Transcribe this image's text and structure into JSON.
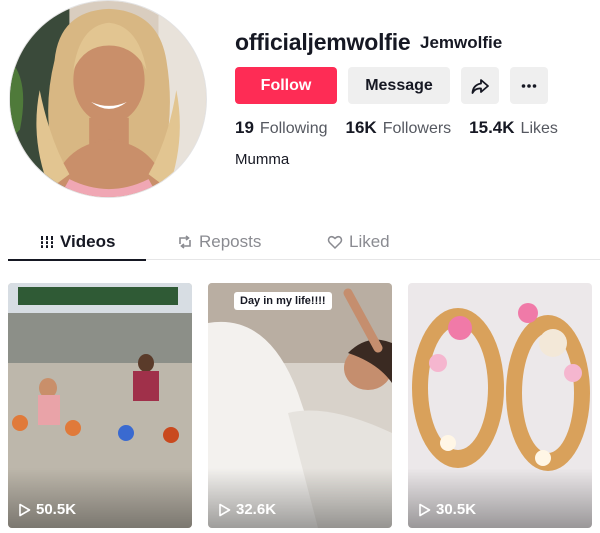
{
  "profile": {
    "username": "officialjemwolfie",
    "nickname": "Jemwolfie",
    "bio": "Mumma"
  },
  "actions": {
    "follow_label": "Follow",
    "message_label": "Message",
    "share_icon": "share-arrow-icon",
    "more_icon": "more-dots-icon"
  },
  "stats": [
    {
      "value": "19",
      "label": "Following"
    },
    {
      "value": "16K",
      "label": "Followers"
    },
    {
      "value": "15.4K",
      "label": "Likes"
    }
  ],
  "tabs": [
    {
      "label": "Videos",
      "icon": "grid-icon",
      "active": true
    },
    {
      "label": "Reposts",
      "icon": "repost-icon",
      "active": false
    },
    {
      "label": "Liked",
      "icon": "heart-icon",
      "active": false
    }
  ],
  "videos": [
    {
      "views": "50.5K",
      "caption": ""
    },
    {
      "views": "32.6K",
      "caption": "Day in my life!!!!"
    },
    {
      "views": "30.5K",
      "caption": ""
    }
  ],
  "colors": {
    "accent": "#fe2c55",
    "text": "#161823",
    "muted": "#555860",
    "button_bg": "#efefef"
  }
}
